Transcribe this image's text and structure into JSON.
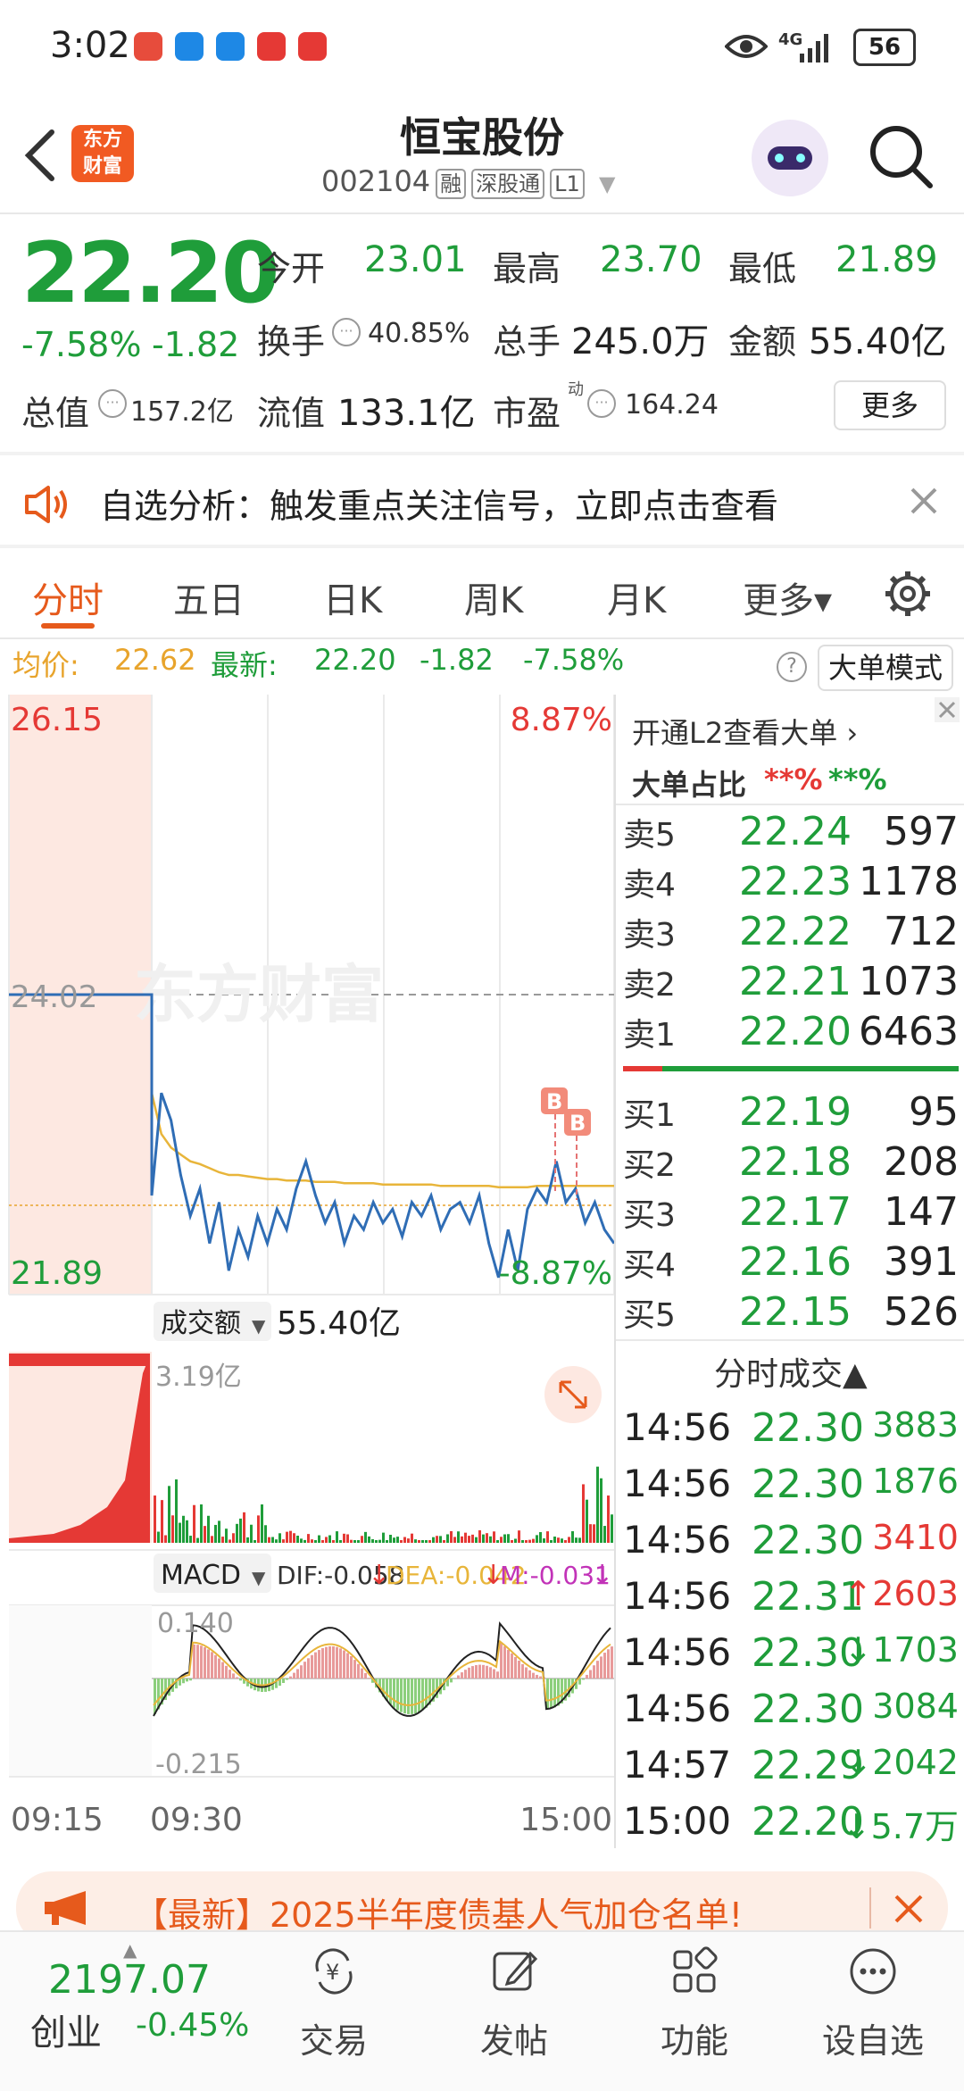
{
  "status_bar": {
    "time": "3:02",
    "network": "4G",
    "battery": "56"
  },
  "header": {
    "back_icon": "chevron-left-icon",
    "logo_text": "东方\n财富",
    "title": "恒宝股份",
    "code": "002104",
    "tags": [
      "融",
      "深股通",
      "L1"
    ],
    "search_icon": "search-icon"
  },
  "quote": {
    "price": "22.20",
    "change_pct": "-7.58%",
    "change": "-1.82",
    "open_label": "今开",
    "open": "23.01",
    "high_label": "最高",
    "high": "23.70",
    "low_label": "最低",
    "low": "21.89",
    "turnover_label": "换手",
    "turnover": "40.85%",
    "volume_label": "总手",
    "volume": "245.0万",
    "amount_label": "金额",
    "amount": "55.40亿",
    "mktcap_label": "总值",
    "mktcap": "157.2亿",
    "float_label": "流值",
    "float": "133.1亿",
    "pe_label": "市盈",
    "pe_sup": "动",
    "pe": "164.24",
    "more_label": "更多"
  },
  "notice": {
    "text": "自选分析：触发重点关注信号，立即点击查看"
  },
  "tabs": [
    {
      "label": "分时",
      "active": true
    },
    {
      "label": "五日"
    },
    {
      "label": "日K"
    },
    {
      "label": "周K"
    },
    {
      "label": "月K"
    },
    {
      "label": "更多▾"
    }
  ],
  "info_line": {
    "avg_label": "均价:",
    "avg": "22.62",
    "latest_label": "最新:",
    "latest": "22.20",
    "chg": "-1.82",
    "chg_pct": "-7.58%",
    "mode_button": "大单模式"
  },
  "chart": {
    "y_top": "26.15",
    "y_mid": "24.02",
    "y_bottom": "21.89",
    "pct_top": "8.87%",
    "pct_bottom": "-8.87%",
    "watermark": "东方财富",
    "markers": [
      "B",
      "B"
    ],
    "vol_selector": "成交额",
    "vol_total": "55.40亿",
    "vol_max": "3.19亿",
    "macd_selector": "MACD",
    "dif": "DIF:-0.058",
    "dea": "DEA:-0.042",
    "m": "M:-0.031",
    "macd_top": "0.140",
    "macd_bottom": "-0.215",
    "x_labels": [
      "09:15",
      "09:30",
      "15:00"
    ],
    "price_series": [
      24.02,
      24.02,
      24.02,
      22.55,
      23.3,
      23.1,
      22.7,
      22.4,
      22.6,
      22.2,
      22.5,
      22.0,
      22.3,
      22.1,
      22.4,
      22.2,
      22.45,
      22.3,
      22.6,
      22.8,
      22.55,
      22.35,
      22.5,
      22.2,
      22.4,
      22.3,
      22.5,
      22.35,
      22.45,
      22.25,
      22.5,
      22.4,
      22.55,
      22.3,
      22.45,
      22.5,
      22.35,
      22.55,
      22.2,
      21.95,
      22.3,
      22.0,
      22.45,
      22.6,
      22.5,
      22.8,
      22.5,
      22.6,
      22.35,
      22.5,
      22.3,
      22.2
    ],
    "avg_series": [
      null,
      null,
      null,
      23.3,
      23.0,
      22.9,
      22.85,
      22.8,
      22.78,
      22.75,
      22.72,
      22.7,
      22.7,
      22.69,
      22.68,
      22.67,
      22.67,
      22.66,
      22.66,
      22.66,
      22.65,
      22.65,
      22.65,
      22.64,
      22.64,
      22.64,
      22.64,
      22.63,
      22.63,
      22.63,
      22.63,
      22.63,
      22.63,
      22.62,
      22.62,
      22.62,
      22.62,
      22.62,
      22.62,
      22.61,
      22.61,
      22.61,
      22.61,
      22.62,
      22.62,
      22.62,
      22.62,
      22.62,
      22.62,
      22.62,
      22.62,
      22.62
    ]
  },
  "order_book_header": {
    "l2_link": "开通L2查看大单",
    "big_ratio": "大单占比",
    "r1": "**%",
    "r2": "**%"
  },
  "asks": [
    {
      "label": "卖5",
      "price": "22.24",
      "vol": "597"
    },
    {
      "label": "卖4",
      "price": "22.23",
      "vol": "1178"
    },
    {
      "label": "卖3",
      "price": "22.22",
      "vol": "712"
    },
    {
      "label": "卖2",
      "price": "22.21",
      "vol": "1073"
    },
    {
      "label": "卖1",
      "price": "22.20",
      "vol": "6463"
    }
  ],
  "bids": [
    {
      "label": "买1",
      "price": "22.19",
      "vol": "95"
    },
    {
      "label": "买2",
      "price": "22.18",
      "vol": "208"
    },
    {
      "label": "买3",
      "price": "22.17",
      "vol": "147"
    },
    {
      "label": "买4",
      "price": "22.16",
      "vol": "391"
    },
    {
      "label": "买5",
      "price": "22.15",
      "vol": "526"
    }
  ],
  "trades_header": "分时成交▲",
  "trades": [
    {
      "time": "14:56",
      "price": "22.30",
      "vol": "3883",
      "color": "green",
      "arrow": ""
    },
    {
      "time": "14:56",
      "price": "22.30",
      "vol": "1876",
      "color": "green",
      "arrow": ""
    },
    {
      "time": "14:56",
      "price": "22.30",
      "vol": "3410",
      "color": "red",
      "arrow": ""
    },
    {
      "time": "14:56",
      "price": "22.31",
      "vol": "2603",
      "color": "red",
      "arrow": "↑"
    },
    {
      "time": "14:56",
      "price": "22.30",
      "vol": "1703",
      "color": "green",
      "arrow": "↓"
    },
    {
      "time": "14:56",
      "price": "22.30",
      "vol": "3084",
      "color": "green",
      "arrow": ""
    },
    {
      "time": "14:57",
      "price": "22.29",
      "vol": "2042",
      "color": "green",
      "arrow": "↓"
    },
    {
      "time": "15:00",
      "price": "22.20",
      "vol": "5.7万",
      "color": "green",
      "arrow": "↓"
    }
  ],
  "banner": {
    "text": "【最新】2025半年度债基人气加仓名单!"
  },
  "bottom_nav": {
    "index_value": "2197.07",
    "index_name": "创业",
    "index_change": "-0.45%",
    "items": [
      "交易",
      "发帖",
      "功能",
      "设自选"
    ]
  },
  "colors": {
    "up": "#e53935",
    "down": "#1f9d3a",
    "accent": "#e65a1c",
    "price_line": "#2f6db5",
    "avg_line": "#e8b53a"
  }
}
